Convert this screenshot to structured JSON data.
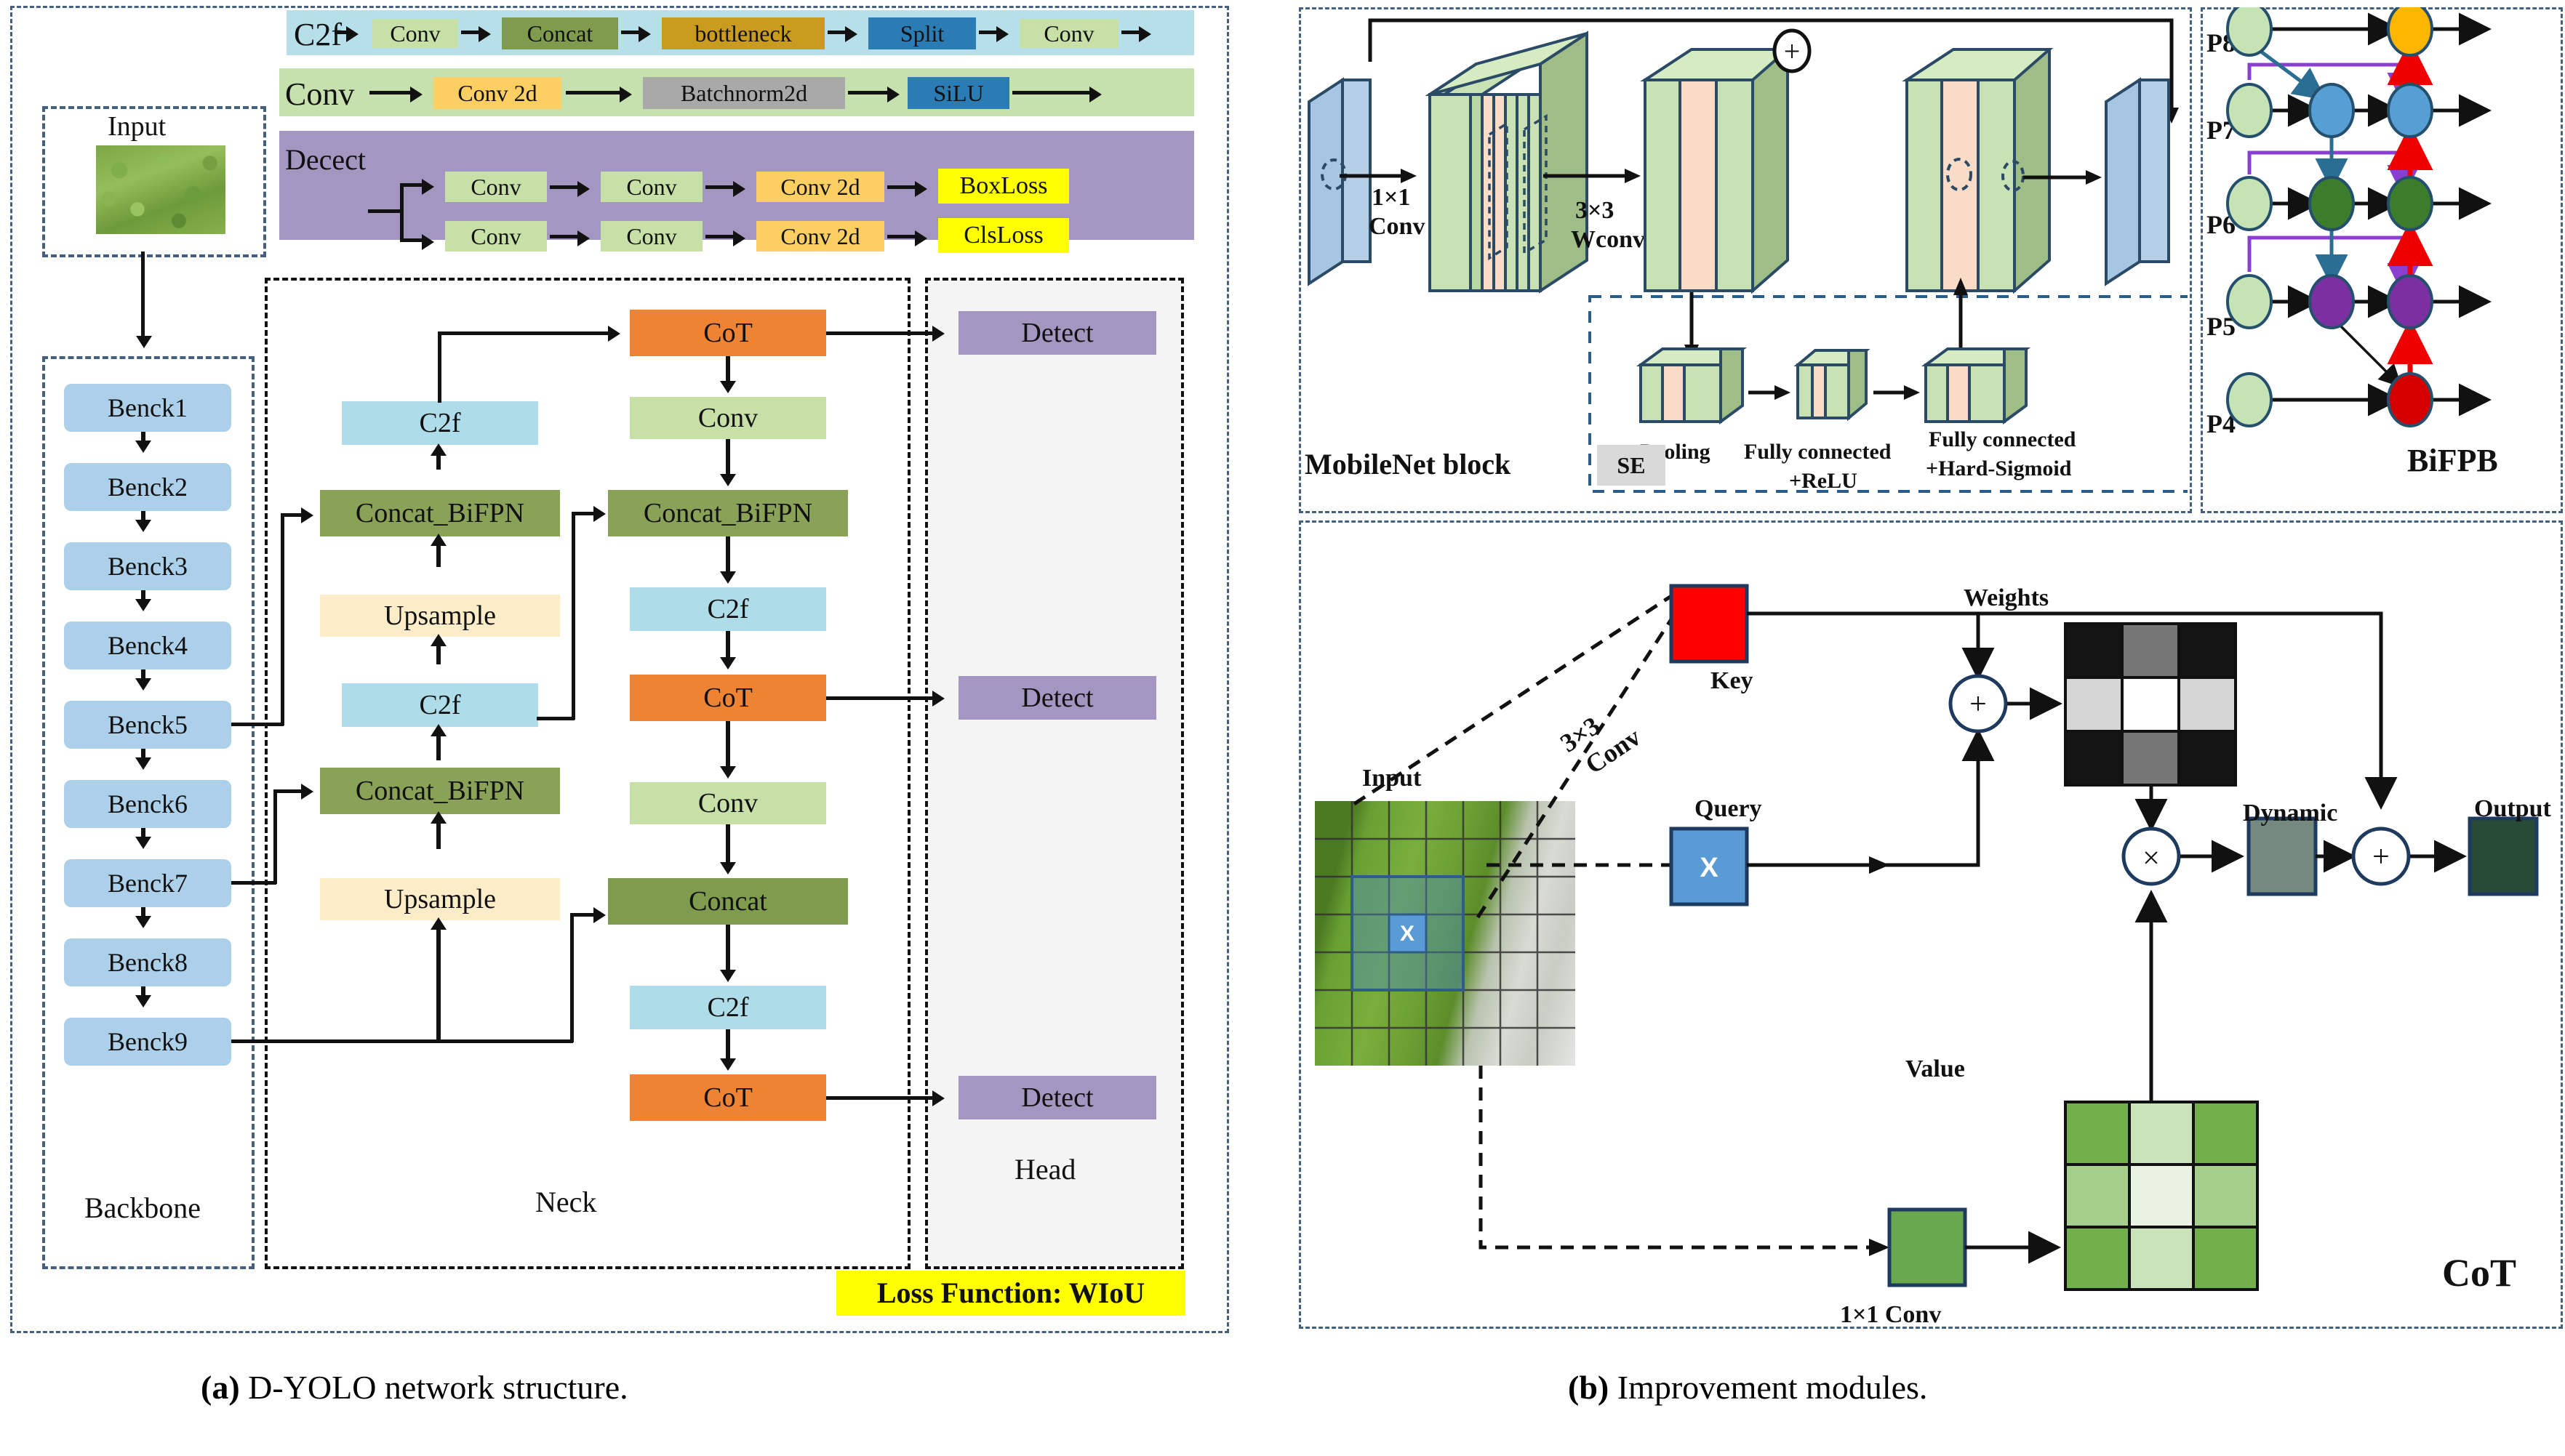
{
  "figure": {
    "caption_a_prefix": "(a)",
    "caption_a": " D-YOLO network structure.",
    "caption_b_prefix": "(b)",
    "caption_b": " Improvement modules."
  },
  "panel_a": {
    "legend": {
      "c2f": {
        "title": "C2f",
        "band_color": "#b7dfea",
        "steps": [
          {
            "label": "Conv",
            "color": "#c7e0a8"
          },
          {
            "label": "Concat",
            "color": "#7f9c4e"
          },
          {
            "label": "bottleneck",
            "color": "#c99b1e"
          },
          {
            "label": "Split",
            "color": "#2b7cb5"
          },
          {
            "label": "Conv",
            "color": "#c7e0a8"
          }
        ]
      },
      "conv": {
        "title": "Conv",
        "band_color": "#c6e0ae",
        "steps": [
          {
            "label": "Conv 2d",
            "color": "#fbcf62"
          },
          {
            "label": "Batchnorm2d",
            "color": "#a9a9a9"
          },
          {
            "label": "SiLU",
            "color": "#2b7cb5"
          }
        ]
      },
      "detect": {
        "title": "Decect",
        "band_color": "#a396c1",
        "row1": [
          {
            "label": "Conv",
            "color": "#c7e0a8"
          },
          {
            "label": "Conv",
            "color": "#c7e0a8"
          },
          {
            "label": "Conv 2d",
            "color": "#fbcf62"
          },
          {
            "label": "BoxLoss",
            "color": "#ffff00"
          }
        ],
        "row2": [
          {
            "label": "Conv",
            "color": "#c7e0a8"
          },
          {
            "label": "Conv",
            "color": "#c7e0a8"
          },
          {
            "label": "Conv 2d",
            "color": "#fbcf62"
          },
          {
            "label": "ClsLoss",
            "color": "#ffff00"
          }
        ]
      }
    },
    "input": {
      "label": "Input"
    },
    "backbone": {
      "label": "Backbone",
      "color": "#acd0e9",
      "blocks": [
        "Benck1",
        "Benck2",
        "Benck3",
        "Benck4",
        "Benck5",
        "Benck6",
        "Benck7",
        "Benck8",
        "Benck9"
      ]
    },
    "neck": {
      "label": "Neck",
      "colors": {
        "c2f": "#aedce8",
        "concat_bifpn": "#8aa257",
        "concat": "#7f9c4e",
        "upsample": "#fcecc8",
        "conv": "#c7e0a8",
        "cot": "#ef8334"
      },
      "left_column": [
        {
          "label": "C2f",
          "type": "c2f"
        },
        {
          "label": "Concat_BiFPN",
          "type": "concat_bifpn"
        },
        {
          "label": "Upsample",
          "type": "upsample"
        },
        {
          "label": "C2f",
          "type": "c2f"
        },
        {
          "label": "Concat_BiFPN",
          "type": "concat_bifpn"
        },
        {
          "label": "Upsample",
          "type": "upsample"
        }
      ],
      "right_column": [
        {
          "label": "CoT",
          "type": "cot"
        },
        {
          "label": "Conv",
          "type": "conv"
        },
        {
          "label": "Concat_BiFPN",
          "type": "concat_bifpn"
        },
        {
          "label": "C2f",
          "type": "c2f"
        },
        {
          "label": "CoT",
          "type": "cot"
        },
        {
          "label": "Conv",
          "type": "conv"
        },
        {
          "label": "Concat",
          "type": "concat"
        },
        {
          "label": "C2f",
          "type": "c2f"
        },
        {
          "label": "CoT",
          "type": "cot"
        }
      ]
    },
    "head": {
      "label": "Head",
      "color": "#a396c1",
      "detects": [
        "Detect",
        "Detect",
        "Detect"
      ]
    },
    "loss": {
      "label": "Loss Function: WIoU",
      "color": "#ffff00"
    }
  },
  "panel_b": {
    "mobilenet": {
      "title": "MobileNet block",
      "labels": {
        "conv1x1": "1×1\nConv",
        "conv1x1_l1": "1×1",
        "conv1x1_l2": "Conv",
        "wconv_l1": "3×3",
        "wconv_l2": "Wconv",
        "plus": "+"
      },
      "se": {
        "tag": "SE",
        "stages": [
          {
            "label": "Pooling"
          },
          {
            "label": "Fully connected\n+ReLU",
            "l1": "Fully connected",
            "l2": "+ReLU"
          },
          {
            "label": "Fully connected\n+Hard-Sigmoid",
            "l1": "Fully connected",
            "l2": "+Hard-Sigmoid"
          }
        ]
      }
    },
    "bifpn": {
      "title": "BiFPB",
      "levels": [
        "P8",
        "P7",
        "P6",
        "P5",
        "P4"
      ],
      "node_colors": {
        "input": "#c5e3b4",
        "p8_out": "#ffb600",
        "p7": "#559fd5",
        "p6": "#3c7d2b",
        "p5": "#7b2fa0",
        "p4_out": "#d40000"
      },
      "edge_colors": {
        "black": "#111111",
        "topdown": "#2b6e93",
        "skip": "#8b3fd1",
        "bottomup": "#ee0000"
      }
    },
    "cot": {
      "title": "CoT",
      "labels": {
        "input": "Input",
        "key": "Key",
        "query": "Query",
        "value": "Value",
        "weights": "Weights",
        "dynamic": "Dynamic",
        "output": "Output",
        "conv3x3_l1": "3×3",
        "conv3x3_l2": "Conv",
        "conv1x1": "1×1 Conv",
        "x": "X",
        "plus": "+",
        "times": "×"
      },
      "colors": {
        "key": "#ff0000",
        "query": "#5b9bd5",
        "value_conv": "#6aa84f",
        "dynamic": "#76897f",
        "output": "#274b37"
      },
      "weights_grid": [
        [
          "#141414",
          "#767676",
          "#141414"
        ],
        [
          "#d6d6d6",
          "#ffffff",
          "#d6d6d6"
        ],
        [
          "#141414",
          "#767676",
          "#141414"
        ]
      ],
      "value_grid": [
        [
          "#72b14a",
          "#cbe3bb",
          "#72b14a"
        ],
        [
          "#a6cf8b",
          "#e9f2e3",
          "#a6cf8b"
        ],
        [
          "#72b14a",
          "#cbe3bb",
          "#72b14a"
        ]
      ]
    }
  }
}
